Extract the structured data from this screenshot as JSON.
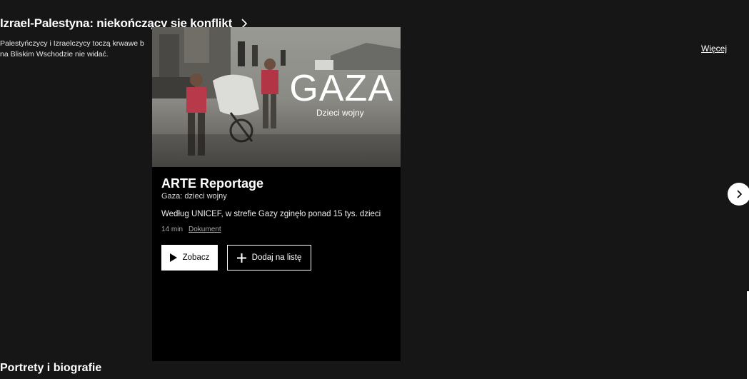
{
  "section": {
    "title": "Izrael-Palestyna: niekończący się konflikt",
    "description_line1": "Palestyńczycy i Izraelczycy toczą krwawe b",
    "description_line2": "na Bliskim Wschodzie nie widać.",
    "more_label": "Więcej"
  },
  "card": {
    "thumbnail": {
      "title": "GAZA",
      "subtitle": "Dzieci wojny"
    },
    "title": "ARTE Reportage",
    "subtitle": "Gaza: dzieci wojny",
    "description": "Według UNICEF, w strefie Gazy zginęło ponad 15 tys. dzieci",
    "duration": "14 min",
    "genre": "Dokument",
    "watch_label": "Zobacz",
    "add_label": "Dodaj na listę"
  },
  "next_section": {
    "title": "Portrety i biografie"
  },
  "icons": {
    "section_chevron": "chevron-right-icon",
    "next": "chevron-right-icon",
    "play": "play-icon",
    "add": "plus-icon"
  }
}
